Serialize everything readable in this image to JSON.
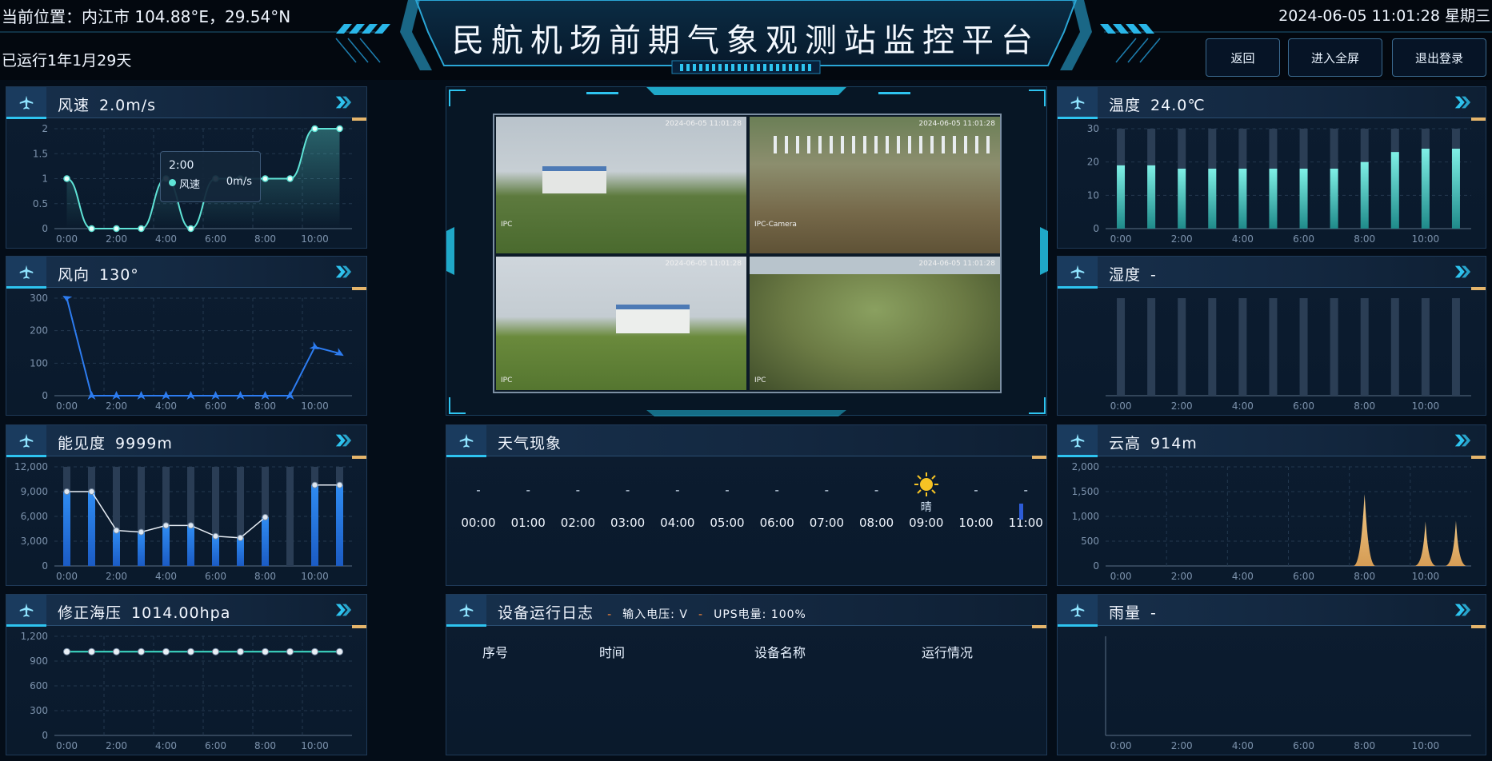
{
  "header": {
    "location": "当前位置：内江市 104.88°E，29.54°N",
    "uptime": "已运行1年1月29天",
    "title": "民航机场前期气象观测站监控平台",
    "datetime": "2024-06-05 11:01:28 星期三",
    "buttons": {
      "back": "返回",
      "fullscreen": "进入全屏",
      "logout": "退出登录"
    }
  },
  "colors": {
    "accent": "#2ec4f0",
    "teal": "#5fe3d6",
    "blue": "#2d7cf0",
    "gold": "#e5b56b",
    "sun": "#f6c324"
  },
  "icons": {
    "panel_icon": "airplane-icon",
    "arrow": "double-chevron-right-icon",
    "sun": "sun-icon"
  },
  "panels": {
    "wind_speed": {
      "label": "风速",
      "value": "2.0m/s"
    },
    "wind_direction": {
      "label": "风向",
      "value": "130°"
    },
    "visibility": {
      "label": "能见度",
      "value": "9999m"
    },
    "pressure": {
      "label": "修正海压",
      "value": "1014.00hpa"
    },
    "temperature": {
      "label": "温度",
      "value": "24.0℃"
    },
    "humidity": {
      "label": "湿度",
      "value": "-"
    },
    "cloud_height": {
      "label": "云高",
      "value": "914m"
    },
    "rainfall": {
      "label": "雨量",
      "value": "-"
    },
    "weather": {
      "label": "天气现象"
    },
    "device_log": {
      "label": "设备运行日志",
      "sep1": "-",
      "voltage": "输入电压: V",
      "sep2": "-",
      "ups": "UPS电量: 100%"
    }
  },
  "tooltip": {
    "time": "2:00",
    "series": "风速",
    "value": "0m/s"
  },
  "cameras": {
    "feeds": [
      {
        "osd_label": "IPC",
        "timestamp": "2024-06-05 11:01:28"
      },
      {
        "osd_label": "IPC-Camera",
        "timestamp": "2024-06-05 11:01:28"
      },
      {
        "osd_label": "IPC",
        "timestamp": "2024-06-05 11:01:28"
      },
      {
        "osd_label": "IPC",
        "timestamp": "2024-06-05 11:01:28"
      }
    ]
  },
  "weather": {
    "slots": [
      {
        "time": "00:00",
        "state": "-"
      },
      {
        "time": "01:00",
        "state": "-"
      },
      {
        "time": "02:00",
        "state": "-"
      },
      {
        "time": "03:00",
        "state": "-"
      },
      {
        "time": "04:00",
        "state": "-"
      },
      {
        "time": "05:00",
        "state": "-"
      },
      {
        "time": "06:00",
        "state": "-"
      },
      {
        "time": "07:00",
        "state": "-"
      },
      {
        "time": "08:00",
        "state": "-"
      },
      {
        "time": "09:00",
        "state": "晴"
      },
      {
        "time": "10:00",
        "state": "-"
      },
      {
        "time": "11:00",
        "state": "-"
      }
    ]
  },
  "log_table": {
    "columns": [
      "序号",
      "时间",
      "设备名称",
      "运行情况"
    ],
    "rows": []
  },
  "chart_data": [
    {
      "id": "wind_speed",
      "type": "line",
      "x": [
        "0:00",
        "1:00",
        "2:00",
        "3:00",
        "4:00",
        "5:00",
        "6:00",
        "7:00",
        "8:00",
        "9:00",
        "10:00",
        "11:00"
      ],
      "xticks": [
        "0:00",
        "2:00",
        "4:00",
        "6:00",
        "8:00",
        "10:00"
      ],
      "yticks": [
        "0",
        "0.5",
        "1",
        "1.5",
        "2"
      ],
      "ylim": [
        0,
        2
      ],
      "series": [
        {
          "name": "风速",
          "values": [
            1,
            0,
            0,
            0,
            1,
            0,
            1,
            1,
            1,
            1,
            2,
            2
          ]
        }
      ]
    },
    {
      "id": "wind_direction",
      "type": "line",
      "x": [
        "0:00",
        "1:00",
        "2:00",
        "3:00",
        "4:00",
        "5:00",
        "6:00",
        "7:00",
        "8:00",
        "9:00",
        "10:00",
        "11:00"
      ],
      "xticks": [
        "0:00",
        "2:00",
        "4:00",
        "6:00",
        "8:00",
        "10:00"
      ],
      "yticks": [
        "0",
        "100",
        "200",
        "300"
      ],
      "ylim": [
        0,
        300
      ],
      "series": [
        {
          "values": [
            300,
            0,
            0,
            0,
            0,
            0,
            0,
            0,
            0,
            0,
            150,
            130
          ]
        }
      ]
    },
    {
      "id": "visibility",
      "type": "bar+line",
      "x": [
        "0:00",
        "1:00",
        "2:00",
        "3:00",
        "4:00",
        "5:00",
        "6:00",
        "7:00",
        "8:00",
        "9:00",
        "10:00",
        "11:00"
      ],
      "xticks": [
        "0:00",
        "2:00",
        "4:00",
        "6:00",
        "8:00",
        "10:00"
      ],
      "yticks": [
        "0",
        "3,000",
        "6,000",
        "9,000",
        "12,000"
      ],
      "ylim": [
        0,
        12000
      ],
      "series": [
        {
          "values": [
            9000,
            9000,
            4300,
            4100,
            4900,
            4900,
            3600,
            3400,
            5900,
            null,
            9800,
            9800
          ]
        }
      ]
    },
    {
      "id": "pressure",
      "type": "line",
      "x": [
        "0:00",
        "1:00",
        "2:00",
        "3:00",
        "4:00",
        "5:00",
        "6:00",
        "7:00",
        "8:00",
        "9:00",
        "10:00",
        "11:00"
      ],
      "xticks": [
        "0:00",
        "2:00",
        "4:00",
        "6:00",
        "8:00",
        "10:00"
      ],
      "yticks": [
        "0",
        "300",
        "600",
        "900",
        "1,200"
      ],
      "ylim": [
        0,
        1200
      ],
      "series": [
        {
          "values": [
            1014,
            1014,
            1014,
            1014,
            1014,
            1014,
            1014,
            1014,
            1014,
            1014,
            1014,
            1014
          ]
        }
      ]
    },
    {
      "id": "temperature",
      "type": "bar",
      "x": [
        "0:00",
        "1:00",
        "2:00",
        "3:00",
        "4:00",
        "5:00",
        "6:00",
        "7:00",
        "8:00",
        "9:00",
        "10:00",
        "11:00"
      ],
      "xticks": [
        "0:00",
        "2:00",
        "4:00",
        "6:00",
        "8:00",
        "10:00"
      ],
      "yticks": [
        "0",
        "10",
        "20",
        "30"
      ],
      "ylim": [
        0,
        30
      ],
      "series": [
        {
          "values": [
            19,
            19,
            18,
            18,
            18,
            18,
            18,
            18,
            20,
            23,
            24,
            24
          ]
        }
      ]
    },
    {
      "id": "humidity",
      "type": "bar",
      "x": [
        "0:00",
        "1:00",
        "2:00",
        "3:00",
        "4:00",
        "5:00",
        "6:00",
        "7:00",
        "8:00",
        "9:00",
        "10:00",
        "11:00"
      ],
      "xticks": [
        "0:00",
        "2:00",
        "4:00",
        "6:00",
        "8:00",
        "10:00"
      ],
      "yticks": [],
      "ylim": [
        0,
        100
      ],
      "series": [
        {
          "values": [
            null,
            null,
            null,
            null,
            null,
            null,
            null,
            null,
            null,
            null,
            null,
            null
          ]
        }
      ]
    },
    {
      "id": "cloud_height",
      "type": "area",
      "x": [
        "0:00",
        "1:00",
        "2:00",
        "3:00",
        "4:00",
        "5:00",
        "6:00",
        "7:00",
        "8:00",
        "9:00",
        "10:00",
        "11:00"
      ],
      "xticks": [
        "0:00",
        "2:00",
        "4:00",
        "6:00",
        "8:00",
        "10:00"
      ],
      "yticks": [
        "0",
        "500",
        "1,000",
        "1,500",
        "2,000"
      ],
      "ylim": [
        0,
        2000
      ],
      "series": [
        {
          "values": [
            0,
            0,
            0,
            0,
            0,
            0,
            0,
            0,
            1450,
            0,
            900,
            914
          ]
        }
      ]
    },
    {
      "id": "rainfall",
      "type": "bar",
      "x": [
        "0:00",
        "1:00",
        "2:00",
        "3:00",
        "4:00",
        "5:00",
        "6:00",
        "7:00",
        "8:00",
        "9:00",
        "10:00",
        "11:00"
      ],
      "xticks": [
        "0:00",
        "2:00",
        "4:00",
        "6:00",
        "8:00",
        "10:00"
      ],
      "yticks": [],
      "ylim": [
        0,
        10
      ],
      "series": [
        {
          "values": []
        }
      ]
    }
  ]
}
